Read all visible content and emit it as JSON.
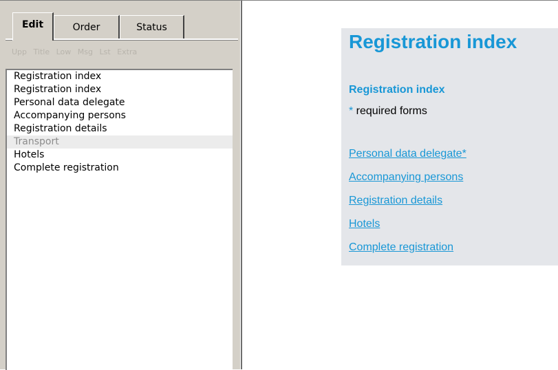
{
  "sidebar": {
    "tabs": [
      {
        "label": "Edit",
        "active": true
      },
      {
        "label": "Order",
        "active": false
      },
      {
        "label": "Status",
        "active": false
      }
    ],
    "toolbar": [
      "Upp",
      "Title",
      "Low",
      "Msg",
      "Lst",
      "Extra"
    ],
    "items": [
      {
        "label": "Registration index",
        "disabled": false
      },
      {
        "label": "Registration index",
        "disabled": false
      },
      {
        "label": "Personal data delegate",
        "disabled": false
      },
      {
        "label": "Accompanying persons",
        "disabled": false
      },
      {
        "label": "Registration details",
        "disabled": false
      },
      {
        "label": "Transport",
        "disabled": true
      },
      {
        "label": "Hotels",
        "disabled": false
      },
      {
        "label": "Complete registration",
        "disabled": false
      }
    ]
  },
  "main": {
    "title": "Registration index",
    "subtitle": "Registration index",
    "required_star": "*",
    "required_text": " required forms",
    "links": [
      "Personal data delegate*",
      "Accompanying persons",
      "Registration details",
      "Hotels",
      "Complete registration"
    ]
  },
  "colors": {
    "accent": "#1897d6",
    "panel_bg": "#d4d0c8",
    "content_bg": "#e4e6ea"
  }
}
